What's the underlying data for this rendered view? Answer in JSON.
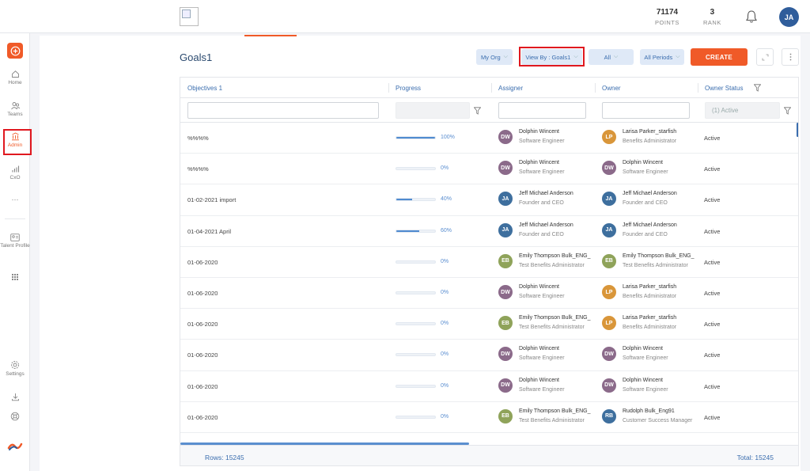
{
  "topbar": {
    "points_value": "71174",
    "points_label": "POINTS",
    "rank_value": "3",
    "rank_label": "RANK",
    "user_initials": "JA"
  },
  "sidebar": {
    "items": [
      {
        "label": "Home",
        "icon": "home-icon"
      },
      {
        "label": "Teams",
        "icon": "teams-icon"
      },
      {
        "label": "Admin",
        "icon": "admin-icon"
      },
      {
        "label": "CxO",
        "icon": "bar-chart-icon"
      },
      {
        "label": "···",
        "icon": "more-icon"
      },
      {
        "label": "Talent Profile",
        "icon": "id-card-icon"
      },
      {
        "label": "",
        "icon": "grid-icon"
      },
      {
        "label": "Settings",
        "icon": "gear-icon"
      },
      {
        "label": "",
        "icon": "download-icon"
      },
      {
        "label": "",
        "icon": "support-icon"
      }
    ],
    "accent_color": "#f05a28"
  },
  "page": {
    "title": "Goals1"
  },
  "toolbar": {
    "my_org": "My Org",
    "view_by": "View By : Goals1",
    "all": "All",
    "all_periods": "All Periods",
    "create": "CREATE"
  },
  "table": {
    "headers": {
      "objectives": "Objectives 1",
      "progress": "Progress",
      "assigner": "Assigner",
      "owner": "Owner",
      "owner_status": "Owner Status"
    },
    "owner_status_filter": "(1) Active",
    "rows": [
      {
        "objective": "%%%%",
        "progress": "100%",
        "progress_value": 1.0,
        "assigner": {
          "initials": "DW",
          "color": "#8b6a8a",
          "name": "Dolphin Wincent",
          "role": "Software Engineer"
        },
        "owner": {
          "initials": "LP",
          "color": "#d9963a",
          "name": "Larisa Parker_starfish",
          "role": "Benefits Administrator"
        },
        "status": "Active"
      },
      {
        "objective": "%%%%",
        "progress": "0%",
        "progress_value": 0.0,
        "assigner": {
          "initials": "DW",
          "color": "#8b6a8a",
          "name": "Dolphin Wincent",
          "role": "Software Engineer"
        },
        "owner": {
          "initials": "DW",
          "color": "#8b6a8a",
          "name": "Dolphin Wincent",
          "role": "Software Engineer"
        },
        "status": "Active"
      },
      {
        "objective": "01-02-2021 import",
        "progress": "40%",
        "progress_value": 0.4,
        "assigner": {
          "initials": "JA",
          "color": "#3e6f9e",
          "name": "Jeff Michael Anderson",
          "role": "Founder and CEO"
        },
        "owner": {
          "initials": "JA",
          "color": "#3e6f9e",
          "name": "Jeff Michael Anderson",
          "role": "Founder and CEO"
        },
        "status": "Active"
      },
      {
        "objective": "01-04-2021 April",
        "progress": "60%",
        "progress_value": 0.6,
        "assigner": {
          "initials": "JA",
          "color": "#3e6f9e",
          "name": "Jeff Michael Anderson",
          "role": "Founder and CEO"
        },
        "owner": {
          "initials": "JA",
          "color": "#3e6f9e",
          "name": "Jeff Michael Anderson",
          "role": "Founder and CEO"
        },
        "status": "Active"
      },
      {
        "objective": "01-06-2020",
        "progress": "0%",
        "progress_value": 0.0,
        "assigner": {
          "initials": "EB",
          "color": "#8fa35a",
          "name": "Emily Thompson Bulk_ENG_",
          "role": "Test Benefits Administrator"
        },
        "owner": {
          "initials": "EB",
          "color": "#8fa35a",
          "name": "Emily Thompson Bulk_ENG_",
          "role": "Test Benefits Administrator"
        },
        "status": "Active"
      },
      {
        "objective": "01-06-2020",
        "progress": "0%",
        "progress_value": 0.0,
        "assigner": {
          "initials": "DW",
          "color": "#8b6a8a",
          "name": "Dolphin Wincent",
          "role": "Software Engineer"
        },
        "owner": {
          "initials": "LP",
          "color": "#d9963a",
          "name": "Larisa Parker_starfish",
          "role": "Benefits Administrator"
        },
        "status": "Active"
      },
      {
        "objective": "01-06-2020",
        "progress": "0%",
        "progress_value": 0.0,
        "assigner": {
          "initials": "EB",
          "color": "#8fa35a",
          "name": "Emily Thompson Bulk_ENG_",
          "role": "Test Benefits Administrator"
        },
        "owner": {
          "initials": "LP",
          "color": "#d9963a",
          "name": "Larisa Parker_starfish",
          "role": "Benefits Administrator"
        },
        "status": "Active"
      },
      {
        "objective": "01-06-2020",
        "progress": "0%",
        "progress_value": 0.0,
        "assigner": {
          "initials": "DW",
          "color": "#8b6a8a",
          "name": "Dolphin Wincent",
          "role": "Software Engineer"
        },
        "owner": {
          "initials": "DW",
          "color": "#8b6a8a",
          "name": "Dolphin Wincent",
          "role": "Software Engineer"
        },
        "status": "Active"
      },
      {
        "objective": "01-06-2020",
        "progress": "0%",
        "progress_value": 0.0,
        "assigner": {
          "initials": "DW",
          "color": "#8b6a8a",
          "name": "Dolphin Wincent",
          "role": "Software Engineer"
        },
        "owner": {
          "initials": "DW",
          "color": "#8b6a8a",
          "name": "Dolphin Wincent",
          "role": "Software Engineer"
        },
        "status": "Active"
      },
      {
        "objective": "01-06-2020",
        "progress": "0%",
        "progress_value": 0.0,
        "assigner": {
          "initials": "EB",
          "color": "#8fa35a",
          "name": "Emily Thompson Bulk_ENG_",
          "role": "Test Benefits Administrator"
        },
        "owner": {
          "initials": "RB",
          "color": "#3e6f9e",
          "name": "Rudolph Bulk_Eng91",
          "role": "Customer Success Manager"
        },
        "status": "Active"
      }
    ],
    "rows_count": "Rows: 15245",
    "total_count": "Total: 15245"
  }
}
